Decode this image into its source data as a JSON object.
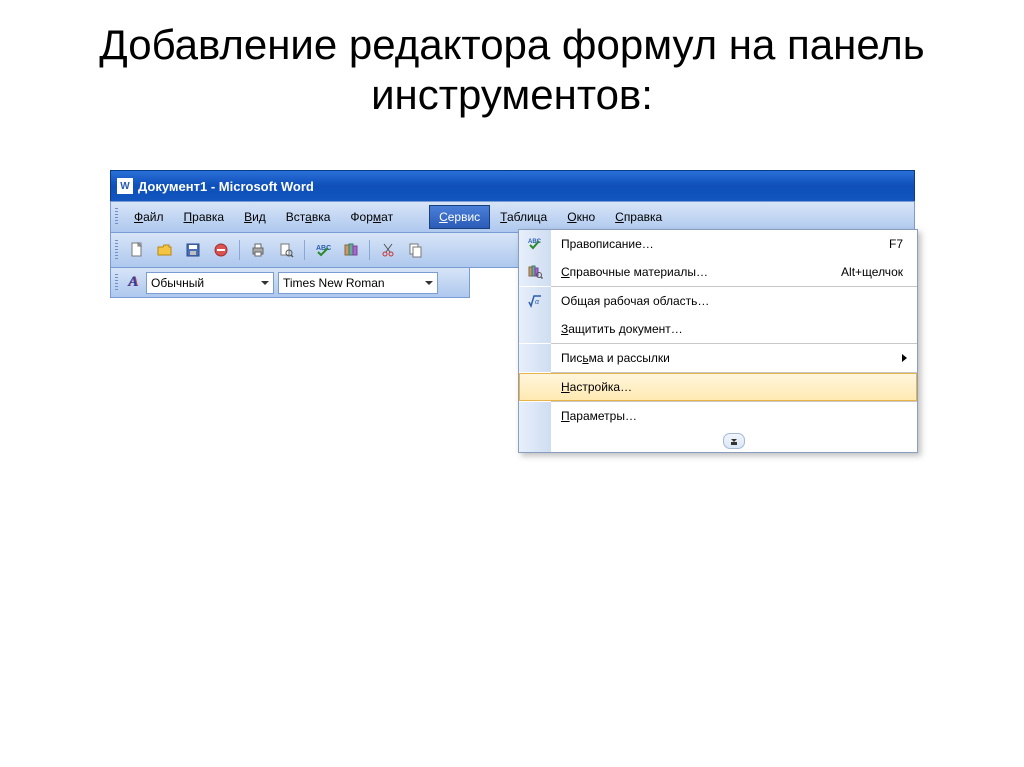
{
  "slide": {
    "title": "Добавление редактора формул на панель инструментов:"
  },
  "window": {
    "title": "Документ1 - Microsoft Word"
  },
  "menubar": {
    "items": [
      {
        "label": "Файл",
        "u": "Ф"
      },
      {
        "label": "Правка",
        "u": "П"
      },
      {
        "label": "Вид",
        "u": "В"
      },
      {
        "label": "Вставка",
        "u": "а"
      },
      {
        "label": "Формат",
        "u": "м"
      },
      {
        "label": "Сервис",
        "u": "С",
        "active": true
      },
      {
        "label": "Таблица",
        "u": "Т"
      },
      {
        "label": "Окно",
        "u": "О"
      },
      {
        "label": "Справка",
        "u": "С"
      }
    ]
  },
  "formatbar": {
    "style_value": "Обычный",
    "font_value": "Times New Roman"
  },
  "dropdown": {
    "items": [
      {
        "label": "Правописание…",
        "shortcut": "F7",
        "icon": "spellcheck"
      },
      {
        "label": "Справочные материалы…",
        "shortcut": "Alt+щелчок",
        "icon": "research",
        "u": "С"
      },
      {
        "sep": true
      },
      {
        "label": "Общая рабочая область…",
        "icon": "sqrt"
      },
      {
        "label": "Защитить документ…",
        "u": "З"
      },
      {
        "sep": true
      },
      {
        "label": "Письма и рассылки",
        "submenu": true,
        "u": "ь"
      },
      {
        "sep": true
      },
      {
        "label": "Настройка…",
        "highlight": true,
        "u": "Н"
      },
      {
        "sep": true
      },
      {
        "label": "Параметры…",
        "u": "П"
      }
    ]
  }
}
